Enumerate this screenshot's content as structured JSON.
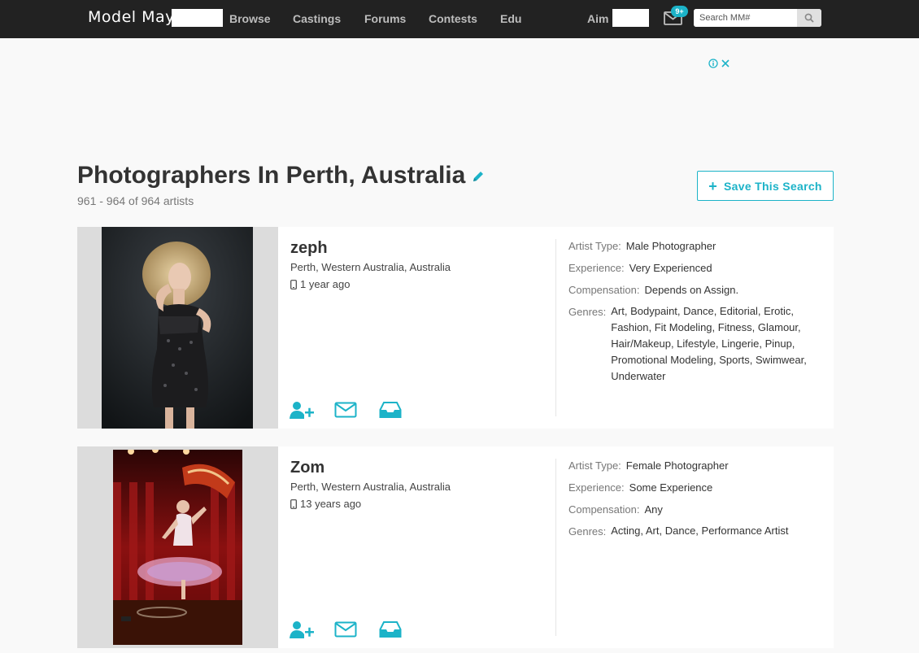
{
  "header": {
    "logo_text": "Model May",
    "nav": [
      "Browse",
      "Castings",
      "Forums",
      "Contests",
      "Edu"
    ],
    "user_name": "Aim",
    "mail_badge": "9+",
    "search_placeholder": "Search MM#"
  },
  "page": {
    "title": "Photographers In Perth, Australia",
    "result_count": "961 - 964 of 964 artists",
    "save_search_label": "Save This Search"
  },
  "labels": {
    "artist_type": "Artist Type:",
    "experience": "Experience:",
    "compensation": "Compensation:",
    "genres": "Genres:"
  },
  "results": [
    {
      "name": "zeph",
      "location": "Perth, Western Australia, Australia",
      "last_seen": "1 year ago",
      "artist_type": "Male Photographer",
      "experience": "Very Experienced",
      "compensation": "Depends on Assign.",
      "genres": "Art, Bodypaint, Dance, Editorial, Erotic, Fashion, Fit Modeling, Fitness, Glamour, Hair/Makeup, Lifestyle, Lingerie, Pinup, Promotional Modeling, Sports, Swimwear, Underwater"
    },
    {
      "name": "Zom",
      "location": "Perth, Western Australia, Australia",
      "last_seen": "13 years ago",
      "artist_type": "Female Photographer",
      "experience": "Some Experience",
      "compensation": "Any",
      "genres": "Acting, Art, Dance, Performance Artist"
    }
  ],
  "colors": {
    "topbar": "#222222",
    "accent": "#1cb3c8",
    "page_bg": "#f9f9f9"
  },
  "icons": [
    "mail-icon",
    "search-icon",
    "info-icon",
    "close-icon",
    "pencil-icon",
    "phone-icon",
    "add-contact-icon",
    "message-icon",
    "inbox-icon"
  ]
}
